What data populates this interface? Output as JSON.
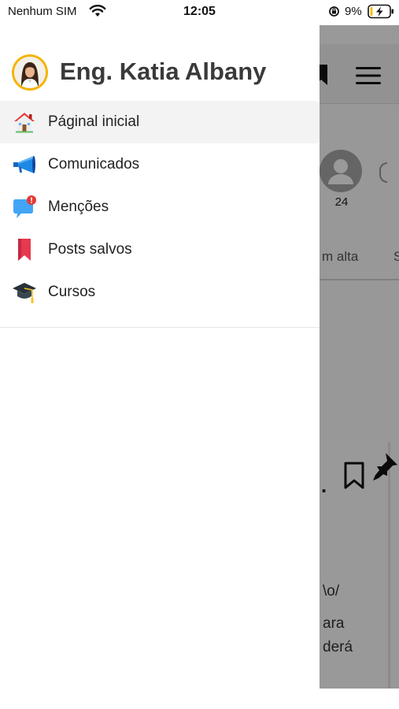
{
  "status_bar": {
    "carrier": "Nenhum SIM",
    "time": "12:05",
    "battery_percent": "9%"
  },
  "drawer": {
    "profile": {
      "name": "Eng. Katia Albany"
    },
    "items": [
      {
        "label": "Páginal inicial",
        "icon": "home-icon",
        "active": true
      },
      {
        "label": "Comunicados",
        "icon": "megaphone-icon",
        "active": false
      },
      {
        "label": "Menções",
        "icon": "chat-bubble-icon",
        "active": false
      },
      {
        "label": "Posts salvos",
        "icon": "bookmark-icon",
        "active": false
      },
      {
        "label": "Cursos",
        "icon": "graduation-cap-icon",
        "active": false
      }
    ]
  },
  "background": {
    "member_count": "24",
    "tab_partial": "m alta",
    "tab2_partial": "S",
    "post_text_lines": [
      "\\o/",
      "ara",
      "derá"
    ]
  },
  "colors": {
    "accent": "#f4b400",
    "active_bg": "#f3f3f3",
    "scrim": "rgba(0,0,0,0.40)"
  }
}
